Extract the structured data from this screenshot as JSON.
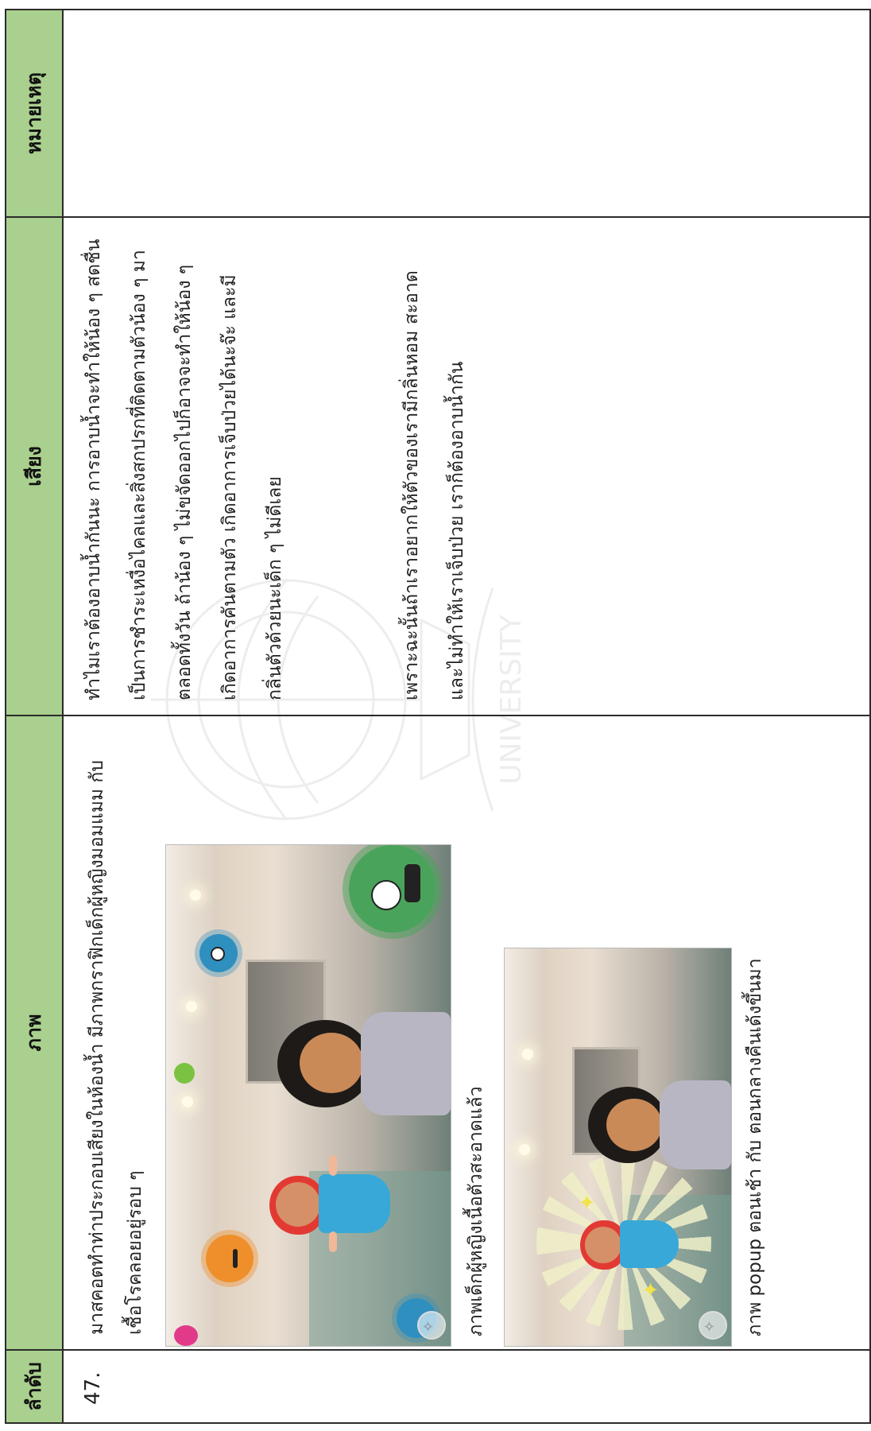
{
  "headers": {
    "number": "ลำดับ",
    "image": "ภาพ",
    "voice": "เสียง",
    "note": "หมายเหตุ"
  },
  "row": {
    "number": "47.",
    "image_desc_1_line1": "มาสคอตทำท่าประกอบเสียงในห้องน้ำ มีภาพกราฟิกเด็กผู้หญิงมอมแมม กับ",
    "image_desc_1_line2": "เชื้อโรคลอยอยู่รอบ ๆ",
    "image_desc_2": "ภาพเด็กผู้หญิงเนื้อตัวสะอาดแล้ว",
    "image_desc_3": "ภาพ popup ตอนเช้า กับ ตอนกลางคืนเด้งขึ้นมา",
    "voice_lines": [
      "ทำไมเราต้องอาบน้ำกันนะ การอาบน้ำจะทำให้น้อง ๆ สดชื่น",
      "เป็นการชำระเหงื่อไคลและสิ่งสกปรกที่ติดตามตัวน้อง ๆ มา",
      "ตลอดทั้งวัน ถ้าน้อง ๆ ไม่ขจัดออกไปก็อาจจะทำให้น้อง ๆ",
      "เกิดอาการคันตามตัว เกิดอาการเจ็บป่วยได้นะจ๊ะ และมี",
      "กลิ่นตัวด้วยนะเด็ก ๆ ไม่ดีเลย"
    ],
    "voice_lines_2": [
      "เพราะฉะนั้นถ้าเราอยากให้ตัวของเรามีกลิ่นหอม สะอาด",
      "และไม่ทำให้เราเจ็บป่วย เราก็ต้องอาบน้ำกัน"
    ],
    "note": ""
  },
  "colors": {
    "header_bg": "#a9d08e",
    "border": "#2b2b2b"
  }
}
